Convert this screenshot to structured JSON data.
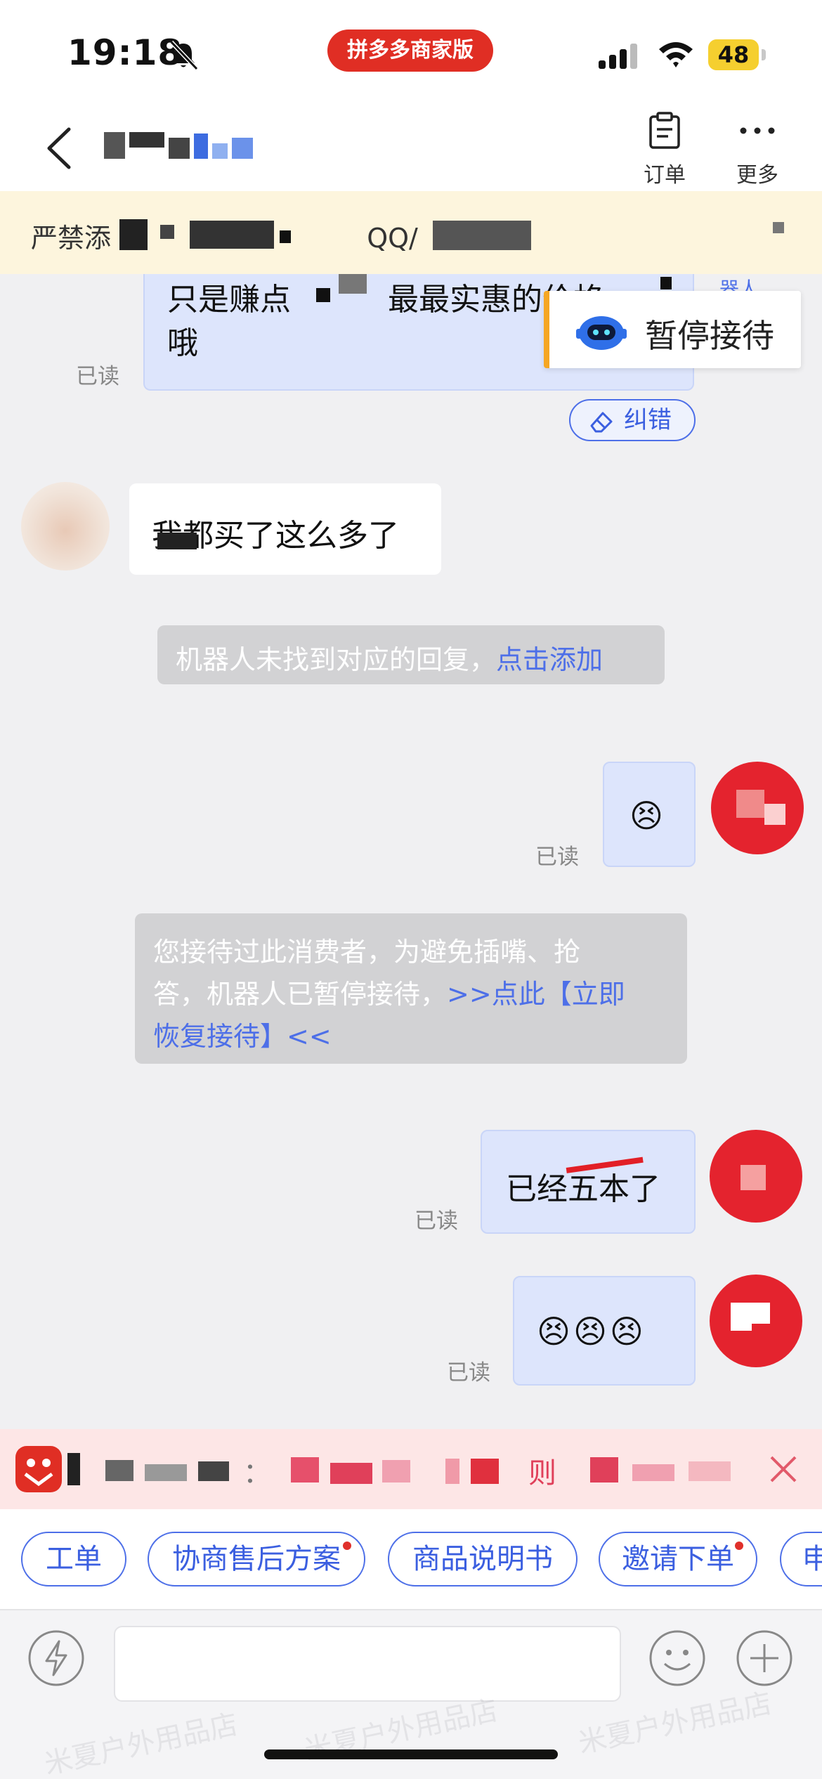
{
  "status_bar": {
    "time": "19:18",
    "app_badge": "拼多多商家版",
    "battery": "48"
  },
  "header": {
    "order_label": "订单",
    "more_label": "更多"
  },
  "notice": {
    "text_part1": "严禁添",
    "text_part2": "QQ/"
  },
  "floating": {
    "pause_label": "暂停接待",
    "robot_tag": "器人"
  },
  "messages": {
    "m1_line1": "只是赚点",
    "m1_line1b": "最最实惠的价格",
    "m1_line2": "哦",
    "m1_read": "已读",
    "correct_label": "纠错",
    "m2_text": "我都买了这么多了",
    "sys1_text": "机器人未找到对应的回复，",
    "sys1_link": "点击添加",
    "m3_emoji": "😣",
    "m3_read": "已读",
    "sys2_line1": "您接待过此消费者，为避免插嘴、抢",
    "sys2_line2a": "答，机器人已暂停接待，",
    "sys2_line2b": ">>点此【立即",
    "sys2_line3": "恢复接待】<<",
    "m4_text": "已经五本了",
    "m4_read": "已读",
    "m5_emoji": "😣😣😣",
    "m5_read": "已读"
  },
  "strip": {
    "text_a": "：",
    "text_b": "则"
  },
  "chips": [
    {
      "label": "工单"
    },
    {
      "label": "协商售后方案"
    },
    {
      "label": "商品说明书"
    },
    {
      "label": "邀请下单"
    },
    {
      "label": "申"
    }
  ],
  "watermark": "米夏户外用品店",
  "colors": {
    "accent": "#4d6fe8",
    "brand_red": "#e02e24",
    "out_bubble": "#dde5fc",
    "notice_bg": "#fdf5dd"
  }
}
